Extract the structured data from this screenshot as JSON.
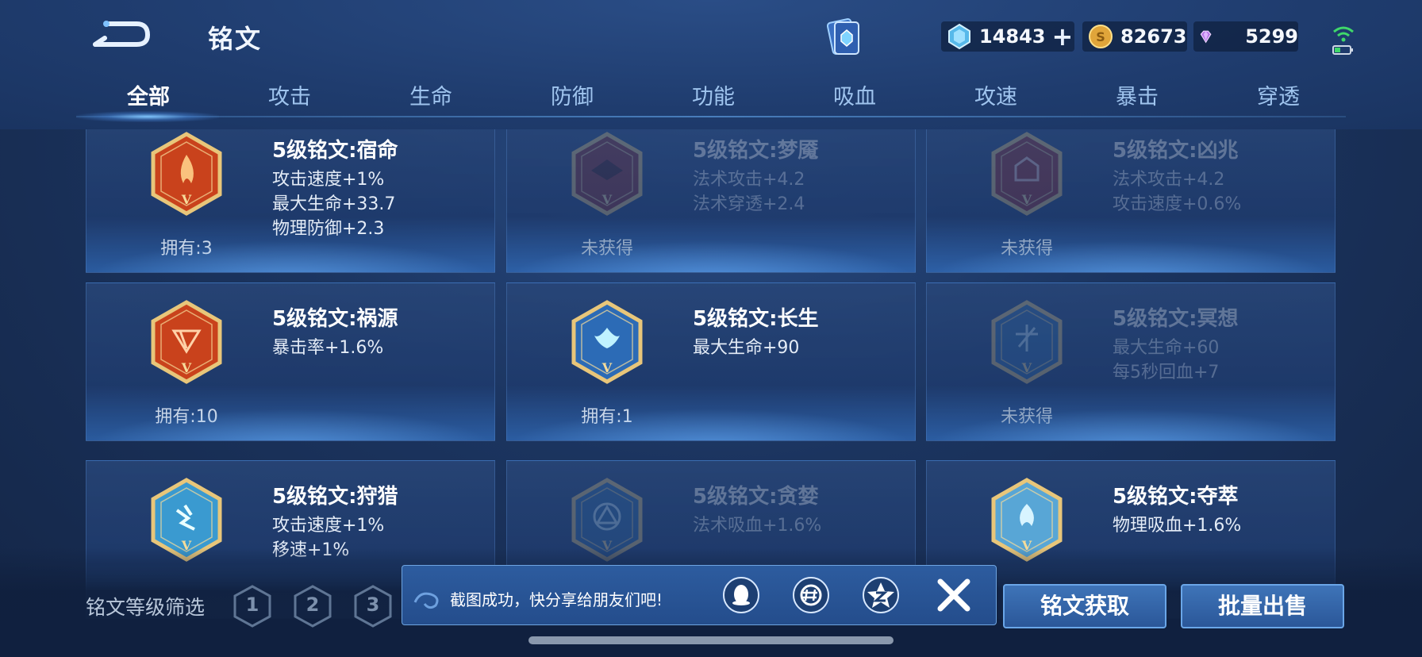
{
  "header": {
    "title": "铭文",
    "currencies": [
      {
        "name": "diamond",
        "icon": "diamond-icon",
        "value": "14843"
      },
      {
        "name": "gold",
        "icon": "gold-coin-icon",
        "value": "82673"
      },
      {
        "name": "gem",
        "icon": "purple-gem-icon",
        "value": "5299"
      }
    ]
  },
  "tabs": [
    "全部",
    "攻击",
    "生命",
    "防御",
    "功能",
    "吸血",
    "攻速",
    "暴击",
    "穿透"
  ],
  "active_tab": "全部",
  "cards": [
    {
      "title": "5级铭文:宿命",
      "stats": [
        "攻击速度+1%",
        "最大生命+33.7",
        "物理防御+2.3"
      ],
      "own": "拥有:3",
      "owned": true,
      "color": "#c9421c"
    },
    {
      "title": "5级铭文:梦魇",
      "stats": [
        "法术攻击+4.2",
        "法术穿透+2.4"
      ],
      "own": "未获得",
      "owned": false,
      "color": "#8e2a2a"
    },
    {
      "title": "5级铭文:凶兆",
      "stats": [
        "法术攻击+4.2",
        "攻击速度+0.6%"
      ],
      "own": "未获得",
      "owned": false,
      "color": "#9b2a2a"
    },
    {
      "title": "5级铭文:祸源",
      "stats": [
        "暴击率+1.6%"
      ],
      "own": "拥有:10",
      "owned": true,
      "color": "#c9421c"
    },
    {
      "title": "5级铭文:长生",
      "stats": [
        "最大生命+90"
      ],
      "own": "拥有:1",
      "owned": true,
      "color": "#2c6bb6"
    },
    {
      "title": "5级铭文:冥想",
      "stats": [
        "最大生命+60",
        "每5秒回血+7"
      ],
      "own": "未获得",
      "owned": false,
      "color": "#2f6aa8"
    },
    {
      "title": "5级铭文:狩猎",
      "stats": [
        "攻击速度+1%",
        "移速+1%"
      ],
      "own": "",
      "owned": true,
      "color": "#3a9ad0"
    },
    {
      "title": "5级铭文:贪婪",
      "stats": [
        "法术吸血+1.6%"
      ],
      "own": "",
      "owned": false,
      "color": "#2f6aa8"
    },
    {
      "title": "5级铭文:夺萃",
      "stats": [
        "物理吸血+1.6%"
      ],
      "own": "",
      "owned": true,
      "color": "#58a6d6"
    }
  ],
  "bottom": {
    "filter_label": "铭文等级筛选",
    "levels": [
      "1",
      "2",
      "3"
    ],
    "get_button": "铭文获取",
    "sell_button": "批量出售"
  },
  "toast": {
    "message": "截图成功，快分享给朋友们吧!",
    "share_targets": [
      "qq-icon",
      "wechat-moments-icon",
      "qzone-icon"
    ]
  }
}
